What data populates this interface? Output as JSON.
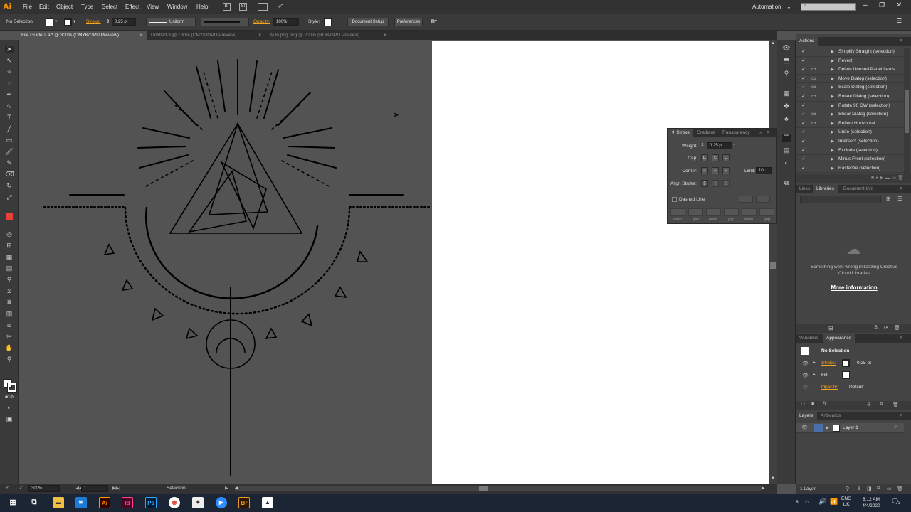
{
  "app": {
    "logo": "Ai",
    "workspace": "Automation",
    "search_placeholder": "",
    "menus": [
      "File",
      "Edit",
      "Object",
      "Type",
      "Select",
      "Effect",
      "View",
      "Window",
      "Help"
    ]
  },
  "control": {
    "selection": "No Selection",
    "stroke_label": "Stroke:",
    "stroke_weight": "0.25 pt",
    "profile": "Uniform",
    "opacity_label": "Opacity:",
    "opacity": "100%",
    "style_label": "Style:",
    "document_setup": "Document Setup",
    "preferences": "Preferences"
  },
  "tabs": [
    {
      "label": "File Guide 2.ai* @ 300% (CMYK/GPU Preview)",
      "active": true
    },
    {
      "label": "Untitled-3 @ 100% (CMYK/GPU Preview)",
      "active": false
    },
    {
      "label": "Ai to png.png @ 200% (RGB/GPU Preview)",
      "active": false
    }
  ],
  "status": {
    "zoom": "300%",
    "artboard": "1",
    "tool": "Selection"
  },
  "actions": {
    "tab": "Actions",
    "items": [
      "Simplify Straight (selection)",
      "Revert",
      "Delete Unused Panel Items",
      "Move Dialog (selection)",
      "Scale Dialog (selection)",
      "Rotate Dialog (selection)",
      "Rotate 90 CW (selection)",
      "Shear Dialog (selection)",
      "Reflect Horizontal",
      "Unite (selection)",
      "Intersect (selection)",
      "Exclude (selection)",
      "Minus Front (selection)",
      "Rasterize (selection)"
    ]
  },
  "libraries": {
    "tabs": [
      "Links",
      "Libraries",
      "Document Info"
    ],
    "error": "Something went wrong initializing Creative Cloud Libraries",
    "link": "More information"
  },
  "appearance": {
    "tabs": [
      "Variables",
      "Appearance"
    ],
    "title": "No Selection",
    "stroke_label": "Stroke:",
    "stroke_value": "0.25 pt",
    "fill_label": "Fill:",
    "opacity_label": "Opacity:",
    "opacity_value": "Default",
    "fx": "fx."
  },
  "layers": {
    "tabs": [
      "Layers",
      "Artboards"
    ],
    "layer": "Layer 1",
    "count": "1 Layer"
  },
  "stroke_panel": {
    "tabs": [
      "Stroke",
      "Gradient",
      "Transparency"
    ],
    "weight_label": "Weight:",
    "weight": "0.25 pt",
    "cap_label": "Cap:",
    "corner_label": "Corner:",
    "limit_label": "Limit:",
    "limit": "10",
    "align_label": "Align Stroke:",
    "dashed": "Dashed Line",
    "dash_labels": [
      "dash",
      "gap",
      "dash",
      "gap",
      "dash",
      "gap"
    ]
  },
  "taskbar": {
    "lang1": "ENG",
    "lang2": "UK",
    "time": "8:12 AM",
    "date": "4/4/2020",
    "notif": "3"
  },
  "colors": {
    "accent": "#f7a51b",
    "ai_orange": "#ff9a00",
    "link_blue": "#4a90d9"
  }
}
